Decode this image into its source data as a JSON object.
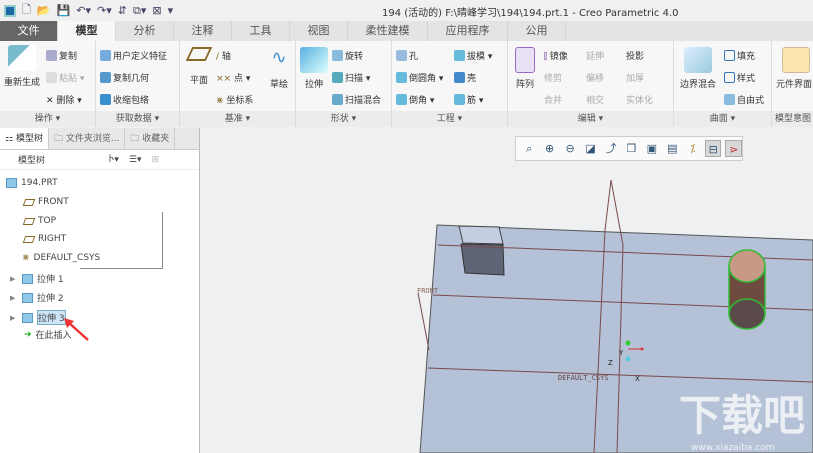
{
  "window": {
    "title": "194 (活动的) F:\\晴峰学习\\194\\194.prt.1 - Creo Parametric 4.0"
  },
  "tabs": [
    "文件",
    "模型",
    "分析",
    "注释",
    "工具",
    "视图",
    "柔性建模",
    "应用程序",
    "公用"
  ],
  "ribbon": {
    "ops": {
      "label": "操作",
      "regen": "重新生成",
      "copy": "复制",
      "paste": "粘贴",
      "delete": "删除"
    },
    "getdata": {
      "label": "获取数据",
      "udf": "用户定义特征",
      "copygeom": "复制几何",
      "shrinkwrap": "收缩包络"
    },
    "datum": {
      "label": "基准",
      "plane": "平面",
      "axis": "轴",
      "point": "点",
      "csys": "坐标系",
      "sketch": "草绘"
    },
    "shapes": {
      "label": "形状",
      "extrude": "拉伸",
      "revolve": "旋转",
      "sweep": "扫描",
      "swept_blend": "扫描混合"
    },
    "eng": {
      "label": "工程",
      "hole": "孔",
      "round": "倒圆角",
      "chamfer": "倒角",
      "draft": "拔模",
      "shell": "壳",
      "rib": "筋"
    },
    "edit": {
      "label": "编辑",
      "pattern": "阵列",
      "mirror": "镜像",
      "extend": "延伸",
      "project": "投影",
      "trim": "修剪",
      "offset": "偏移",
      "thicken": "加厚",
      "merge": "合并",
      "intersect": "相交",
      "solidify": "实体化"
    },
    "surfaces": {
      "label": "曲面",
      "boundary": "边界混合",
      "fill": "填充",
      "style": "样式",
      "freestyle": "自由式"
    },
    "intent": {
      "label": "模型意图",
      "component": "元件界面"
    }
  },
  "panel": {
    "tabs": [
      "模型树",
      "文件夹浏览...",
      "收藏夹"
    ],
    "toolbar_title": "模型树",
    "tree": [
      "194.PRT",
      "FRONT",
      "TOP",
      "RIGHT",
      "DEFAULT_CSYS",
      "拉伸 1",
      "拉伸 2",
      "拉伸 3",
      "在此插入"
    ]
  },
  "viewport": {
    "labels": {
      "front": "FRONT",
      "csys": "DEFAULT_CSYS",
      "x": "X",
      "y": "Y",
      "z": "Z"
    },
    "watermark": "下载吧",
    "watermark_url": "www.xiazaiba.com"
  }
}
